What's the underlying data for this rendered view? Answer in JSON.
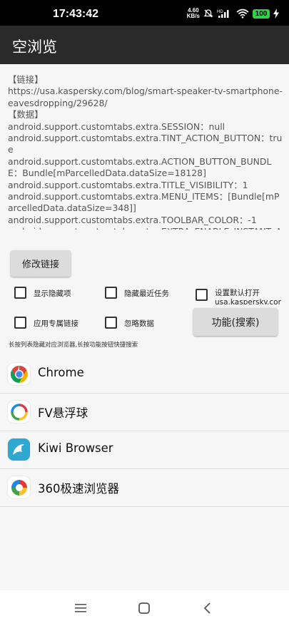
{
  "status": {
    "time": "17:43:42",
    "net_speed_value": "4.60",
    "net_speed_unit": "KB/s",
    "battery": "100",
    "icons": [
      "mute-icon",
      "hd-icon",
      "signal-icon",
      "wifi-icon",
      "battery-icon",
      "charging-icon"
    ]
  },
  "app": {
    "title": "空浏览"
  },
  "info": {
    "text": "【链接】\nhttps://usa.kaspersky.com/blog/smart-speaker-tv-smartphone-eavesdropping/29628/\n【数据】\nandroid.support.customtabs.extra.SESSION：null\nandroid.support.customtabs.extra.TINT_ACTION_BUTTON：true\nandroid.support.customtabs.extra.ACTION_BUTTON_BUNDLE：Bundle[mParcelledData.dataSize=18128]\nandroid.support.customtabs.extra.TITLE_VISIBILITY：1\nandroid.support.customtabs.extra.MENU_ITEMS：[Bundle[mParcelledData.dataSize=348]]\nandroid.support.customtabs.extra.TOOLBAR_COLOR：-1\nandroid.support.customtabs.extra.EXTRA_ENABLE_INSTANT_APPS："
  },
  "buttons": {
    "modify_link": "修改链接",
    "function_search": "功能(搜索)"
  },
  "checkboxes": {
    "show_hidden": "显示隐藏项",
    "hide_recent": "隐藏最近任务",
    "set_default": "设置默认打开 usa.kaspersky.com",
    "app_link": "应用专属链接",
    "ignore_data": "忽略数据"
  },
  "hint": "长按列表隐藏对应浏览器,长按功能按钮快捷搜索",
  "browsers": [
    {
      "name": "Chrome",
      "icon": "chrome-icon"
    },
    {
      "name": "FV悬浮球",
      "icon": "fv-floating-ball-icon"
    },
    {
      "name": "Kiwi Browser",
      "icon": "kiwi-bird-icon"
    },
    {
      "name": "360极速浏览器",
      "icon": "360-browser-icon"
    }
  ],
  "nav": {
    "icons": [
      "menu-icon",
      "home-icon",
      "back-icon"
    ]
  },
  "colors": {
    "app_bar": "#2a2a2a",
    "status_bar": "#000000",
    "battery": "#2fd24a",
    "background": "#f6f6f6"
  }
}
